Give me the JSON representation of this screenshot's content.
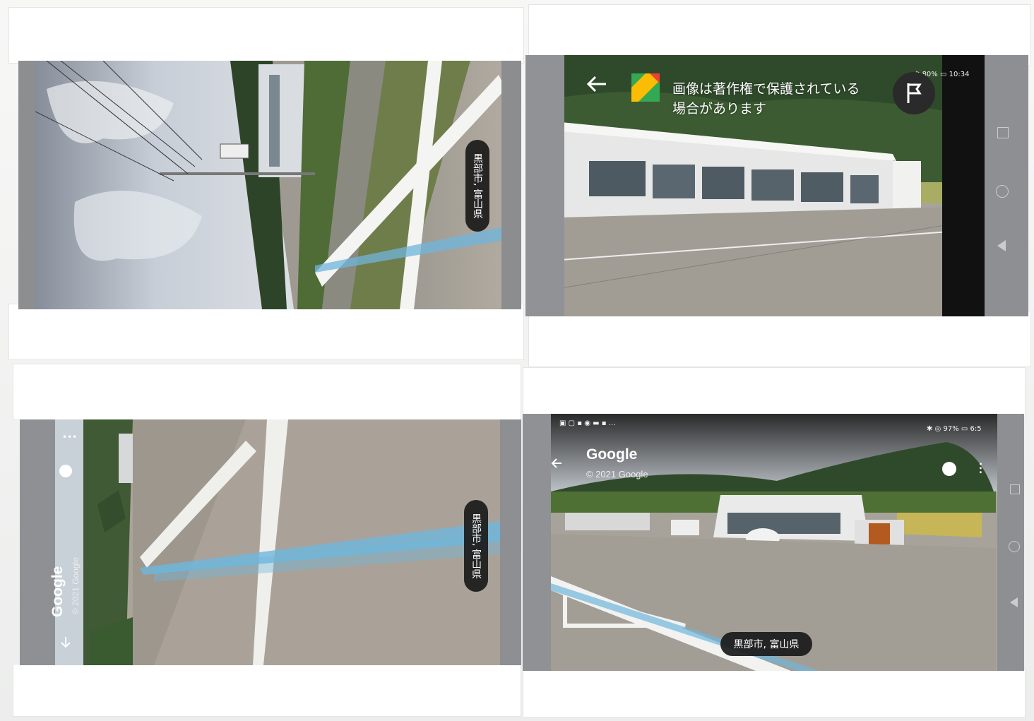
{
  "panels": {
    "top_left": {
      "location_label": "黒部市, 富山県"
    },
    "top_right": {
      "status_bar": {
        "battery": "80%",
        "time": "10:34"
      },
      "copyright_notice": [
        "画像は著作権で保護されている",
        "場合があります"
      ]
    },
    "bottom_left": {
      "title": "Google",
      "copyright": "© 2021 Google",
      "location_label": "黒部市, 富山県"
    },
    "bottom_right": {
      "status_bar": {
        "battery": "97%",
        "time": "6:5"
      },
      "title": "Google",
      "copyright": "© 2021 Google",
      "location_label": "黒部市, 富山県"
    }
  },
  "icons": {
    "back": "arrow-left-icon",
    "maps_logo": "google-maps-icon",
    "report": "flag-icon",
    "compass": "compass-icon",
    "menu": "more-vert-icon",
    "nav_back": "triangle-back-icon",
    "nav_home": "circle-home-icon",
    "nav_recent": "square-recent-icon"
  },
  "colors": {
    "route_line": "#6fb6dc",
    "pill_bg": "#1a1a1a",
    "sky": "#c9d0d8",
    "forest": "#2f4a2a",
    "road": "#a9a49c"
  }
}
